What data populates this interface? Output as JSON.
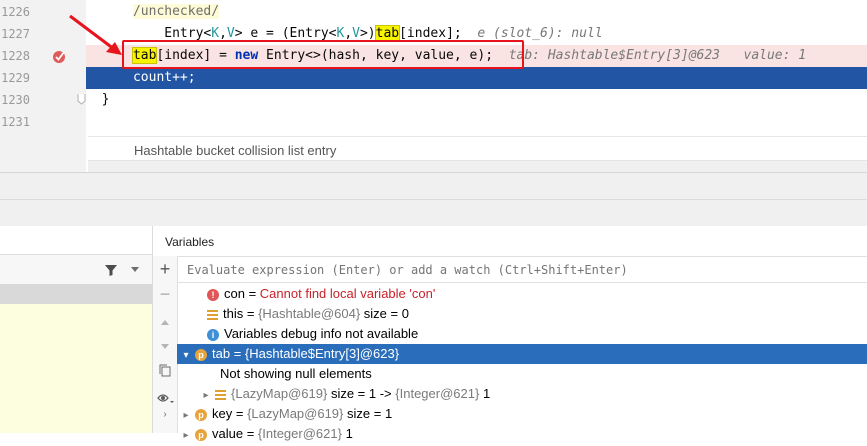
{
  "editor": {
    "line_numbers": [
      "1226",
      "1227",
      "1228",
      "1229",
      "1230",
      "1231"
    ],
    "line1226": "/unchecked/",
    "line1227": {
      "code_a": "Entry<",
      "code_k": "K",
      "code_comma": ",",
      "code_v": "V",
      "code_b": "> e = (Entry<",
      "code_k2": "K",
      "code_comma2": ",",
      "code_v2": "V",
      "code_c": ">)",
      "code_tab": "tab",
      "code_d": "[index];",
      "hint": "e (slot_6): null"
    },
    "line1228": {
      "code_tab": "tab",
      "code_a": "[index] = ",
      "code_new": "new",
      "code_b": " Entry<>(hash, key, value, e);",
      "hint": "tab: Hashtable$Entry[3]@623   value: 1"
    },
    "line1229": "count++;",
    "line1230": "}",
    "doc_note": "Hashtable bucket collision list entry"
  },
  "debugger": {
    "variables_title": "Variables",
    "eval_placeholder": "Evaluate expression (Enter) or add a watch (Ctrl+Shift+Enter)",
    "rows": [
      {
        "name": "con",
        "eq": " = ",
        "value": "Cannot find local variable 'con'"
      },
      {
        "name": "this",
        "eq": " = ",
        "type": "{Hashtable@604}",
        "extra": "size = 0"
      },
      {
        "text": "Variables debug info not available"
      },
      {
        "name": "tab",
        "eq": " = ",
        "type": "{Hashtable$Entry[3]@623}"
      },
      {
        "text": "Not showing null elements"
      },
      {
        "type": "{LazyMap@619}",
        "extra": "size = 1 ->",
        "type2": "{Integer@621}",
        "extra2": "1"
      },
      {
        "name": "key",
        "eq": " = ",
        "type": "{LazyMap@619}",
        "extra": "size = 1"
      },
      {
        "name": "value",
        "eq": " = ",
        "type": "{Integer@621}",
        "extra": "1"
      }
    ]
  },
  "colors": {
    "breakpoint_line": "#fae3e3",
    "current_line": "#2255a4",
    "selected_row": "#2a6ebb",
    "annotation_red": "#e8141d"
  }
}
